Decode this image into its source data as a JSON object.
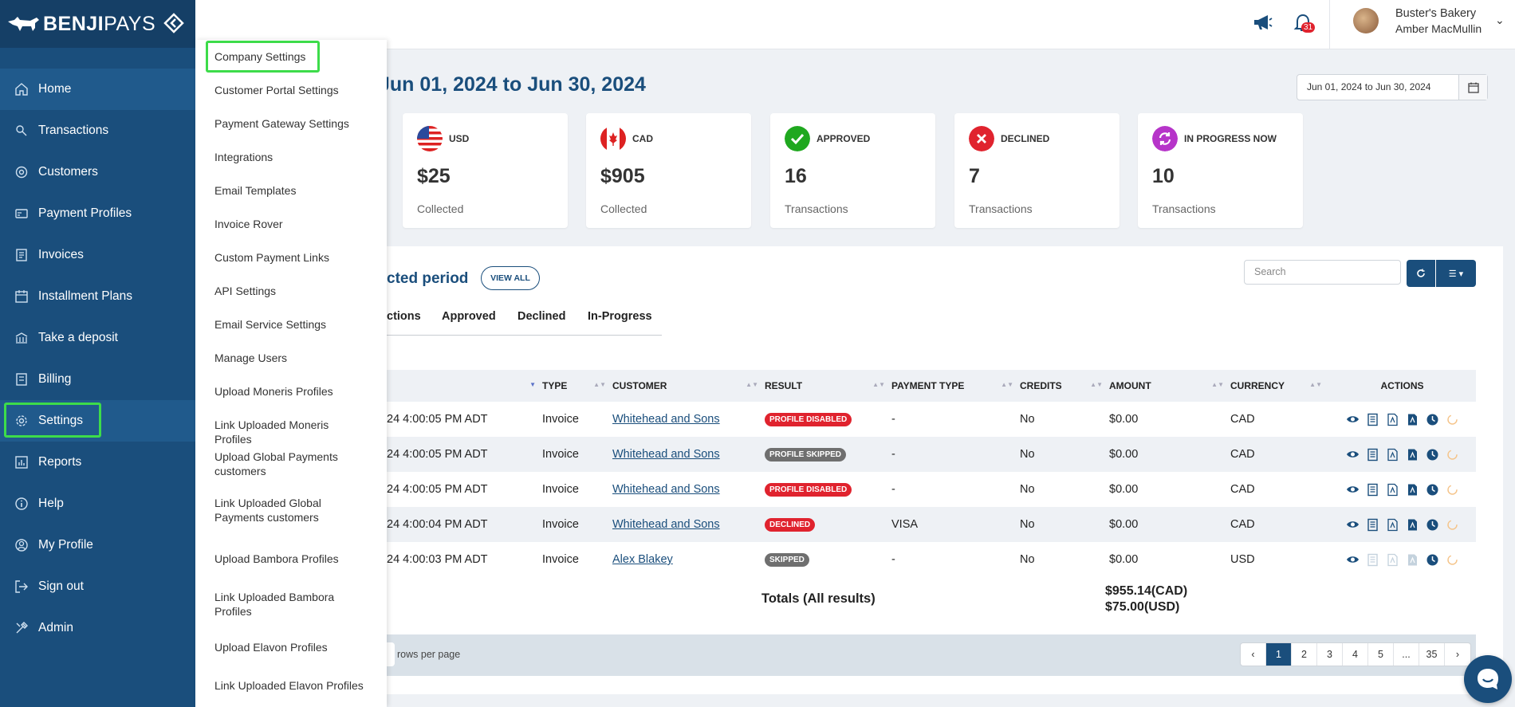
{
  "brand": {
    "name_bold": "BENJI",
    "name_light": "PAYS"
  },
  "sidebar": {
    "items": [
      {
        "label": "Home",
        "icon": "home-icon"
      },
      {
        "label": "Transactions",
        "icon": "transactions-icon"
      },
      {
        "label": "Customers",
        "icon": "customers-icon"
      },
      {
        "label": "Payment Profiles",
        "icon": "payment-profiles-icon"
      },
      {
        "label": "Invoices",
        "icon": "invoices-icon"
      },
      {
        "label": "Installment Plans",
        "icon": "installment-plans-icon"
      },
      {
        "label": "Take a deposit",
        "icon": "deposit-icon"
      },
      {
        "label": "Billing",
        "icon": "billing-icon"
      },
      {
        "label": "Settings",
        "icon": "gear-icon"
      },
      {
        "label": "Reports",
        "icon": "reports-icon"
      },
      {
        "label": "Help",
        "icon": "help-icon"
      },
      {
        "label": "My Profile",
        "icon": "profile-icon"
      },
      {
        "label": "Sign out",
        "icon": "sign-out-icon"
      },
      {
        "label": "Admin",
        "icon": "admin-icon"
      }
    ]
  },
  "settings_menu": {
    "items": [
      "Company Settings",
      "Customer Portal Settings",
      "Payment Gateway Settings",
      "Integrations",
      "Email Templates",
      "Invoice Rover",
      "Custom Payment Links",
      "API Settings",
      "Email Service Settings",
      "Manage Users",
      "Upload Moneris Profiles",
      "Link Uploaded Moneris Profiles",
      "Upload Global Payments customers",
      "Link Uploaded Global Payments customers",
      "Upload Bambora Profiles",
      "Link Uploaded Bambora Profiles",
      "Upload Elavon Profiles",
      "Link Uploaded Elavon Profiles"
    ]
  },
  "topbar": {
    "notifications_count": "31",
    "company": "Buster's Bakery",
    "user": "Amber MacMullin"
  },
  "main": {
    "title": "Jun 01, 2024 to Jun 30, 2024",
    "date_range": "Jun 01, 2024 to Jun 30, 2024",
    "cards": [
      {
        "label": "USD",
        "value": "$25",
        "sub": "Collected",
        "icon": "us-flag-icon"
      },
      {
        "label": "CAD",
        "value": "$905",
        "sub": "Collected",
        "icon": "canada-flag-icon"
      },
      {
        "label": "APPROVED",
        "value": "16",
        "sub": "Transactions",
        "icon": "check-icon",
        "color": "#1fa81f"
      },
      {
        "label": "DECLINED",
        "value": "7",
        "sub": "Transactions",
        "icon": "x-icon",
        "color": "#e0232e"
      },
      {
        "label": "IN PROGRESS NOW",
        "value": "10",
        "sub": "Transactions",
        "icon": "refresh-icon",
        "color": "#b634c9"
      }
    ],
    "section_title": "cted period",
    "view_all": "VIEW ALL",
    "search_placeholder": "Search",
    "tabs": [
      "ctions",
      "Approved",
      "Declined",
      "In-Progress"
    ],
    "table": {
      "headers": [
        "",
        "TYPE",
        "CUSTOMER",
        "RESULT",
        "PAYMENT TYPE",
        "CREDITS",
        "AMOUNT",
        "CURRENCY",
        "ACTIONS"
      ],
      "rows": [
        {
          "date": "24 4:00:05 PM ADT",
          "type": "Invoice",
          "customer": "Whitehead and Sons",
          "result": "PROFILE DISABLED",
          "result_color": "#e0232e",
          "payment_type": "-",
          "credits": "No",
          "amount": "$0.00",
          "currency": "CAD"
        },
        {
          "date": "24 4:00:05 PM ADT",
          "type": "Invoice",
          "customer": "Whitehead and Sons",
          "result": "PROFILE SKIPPED",
          "result_color": "#6f6f6f",
          "payment_type": "-",
          "credits": "No",
          "amount": "$0.00",
          "currency": "CAD"
        },
        {
          "date": "24 4:00:05 PM ADT",
          "type": "Invoice",
          "customer": "Whitehead and Sons",
          "result": "PROFILE DISABLED",
          "result_color": "#e0232e",
          "payment_type": "-",
          "credits": "No",
          "amount": "$0.00",
          "currency": "CAD"
        },
        {
          "date": "24 4:00:04 PM ADT",
          "type": "Invoice",
          "customer": "Whitehead and Sons",
          "result": "DECLINED",
          "result_color": "#e0232e",
          "payment_type": "VISA",
          "credits": "No",
          "amount": "$0.00",
          "currency": "CAD"
        },
        {
          "date": "24 4:00:03 PM ADT",
          "type": "Invoice",
          "customer": "Alex Blakey",
          "result": "SKIPPED",
          "result_color": "#6f6f6f",
          "payment_type": "-",
          "credits": "No",
          "amount": "$0.00",
          "currency": "USD"
        }
      ]
    },
    "totals_label": "Totals (All results)",
    "totals_cad": "$955.14(CAD)",
    "totals_usd": "$75.00(USD)",
    "rows_per_page": "rows per page",
    "pages": [
      "‹",
      "1",
      "2",
      "3",
      "4",
      "5",
      "...",
      "35",
      "›"
    ],
    "active_page": "1"
  },
  "colors": {
    "brand": "#1a4e7c",
    "highlight": "#3ddc4a"
  }
}
